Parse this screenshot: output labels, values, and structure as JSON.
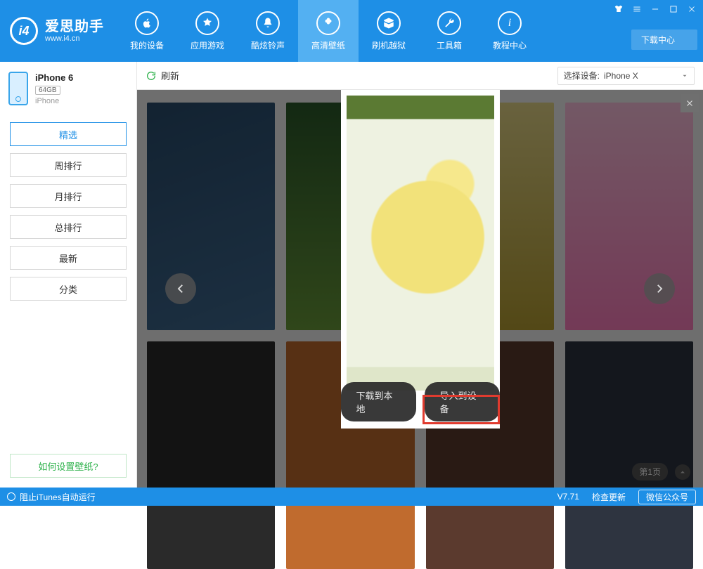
{
  "app": {
    "name_cn": "爱思助手",
    "name_en": "www.i4.cn"
  },
  "nav": {
    "items": [
      {
        "label": "我的设备",
        "icon": "apple"
      },
      {
        "label": "应用游戏",
        "icon": "appstore"
      },
      {
        "label": "酷炫铃声",
        "icon": "bell"
      },
      {
        "label": "高清壁纸",
        "icon": "flower"
      },
      {
        "label": "刷机越狱",
        "icon": "box"
      },
      {
        "label": "工具箱",
        "icon": "wrench"
      },
      {
        "label": "教程中心",
        "icon": "info"
      }
    ],
    "active_index": 3
  },
  "download_center": "下载中心",
  "toolbar": {
    "refresh": "刷新",
    "device_label": "选择设备:",
    "device_value": "iPhone X"
  },
  "sidebar": {
    "device_name": "iPhone 6",
    "storage": "64GB",
    "device_type": "iPhone",
    "categories": [
      "精选",
      "周排行",
      "月排行",
      "总排行",
      "最新",
      "分类"
    ],
    "active_index": 0,
    "help_link": "如何设置壁纸?"
  },
  "modal": {
    "download_local": "下载到本地",
    "import_device": "导入到设备"
  },
  "pager": {
    "label": "第1页"
  },
  "statusbar": {
    "itunes": "阻止iTunes自动运行",
    "version": "V7.71",
    "check_update": "检查更新",
    "wechat": "微信公众号"
  }
}
